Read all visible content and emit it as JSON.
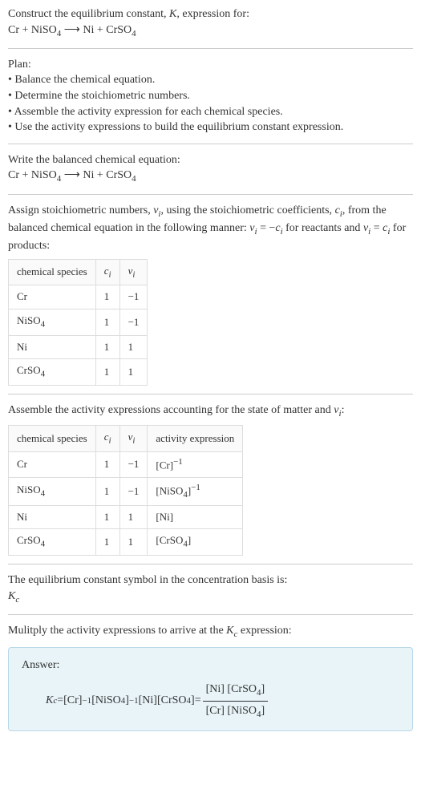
{
  "intro": {
    "line1_prefix": "Construct the equilibrium constant, ",
    "line1_K": "K",
    "line1_suffix": ", expression for:",
    "equation_lhs1": "Cr + NiSO",
    "equation_sub1": "4",
    "equation_arrow": " ⟶ ",
    "equation_rhs1": "Ni + CrSO",
    "equation_sub2": "4"
  },
  "plan": {
    "title": "Plan:",
    "item1": "• Balance the chemical equation.",
    "item2": "• Determine the stoichiometric numbers.",
    "item3": "• Assemble the activity expression for each chemical species.",
    "item4": "• Use the activity expressions to build the equilibrium constant expression."
  },
  "balanced": {
    "title": "Write the balanced chemical equation:",
    "equation_lhs1": "Cr + NiSO",
    "equation_sub1": "4",
    "equation_arrow": " ⟶ ",
    "equation_rhs1": "Ni + CrSO",
    "equation_sub2": "4"
  },
  "stoich": {
    "line1_a": "Assign stoichiometric numbers, ",
    "line1_nu": "ν",
    "line1_i": "i",
    "line1_b": ", using the stoichiometric coefficients, ",
    "line1_c": "c",
    "line1_d": ", from the balanced chemical equation in the following manner: ",
    "line1_e": " = −",
    "line1_f": " for reactants and ",
    "line1_g": " = ",
    "line1_h": " for products:",
    "table": {
      "h1": "chemical species",
      "h2": "c",
      "h2sub": "i",
      "h3": "ν",
      "h3sub": "i",
      "rows": [
        {
          "sp": "Cr",
          "c": "1",
          "nu": "−1"
        },
        {
          "sp_a": "NiSO",
          "sp_sub": "4",
          "c": "1",
          "nu": "−1"
        },
        {
          "sp": "Ni",
          "c": "1",
          "nu": "1"
        },
        {
          "sp_a": "CrSO",
          "sp_sub": "4",
          "c": "1",
          "nu": "1"
        }
      ]
    }
  },
  "activity": {
    "title_a": "Assemble the activity expressions accounting for the state of matter and ",
    "title_nu": "ν",
    "title_i": "i",
    "title_b": ":",
    "table": {
      "h1": "chemical species",
      "h2": "c",
      "h2sub": "i",
      "h3": "ν",
      "h3sub": "i",
      "h4": "activity expression",
      "rows": [
        {
          "sp": "Cr",
          "c": "1",
          "nu": "−1",
          "act_a": "[Cr]",
          "act_sup": "−1"
        },
        {
          "sp_a": "NiSO",
          "sp_sub": "4",
          "c": "1",
          "nu": "−1",
          "act_a": "[NiSO",
          "act_sub": "4",
          "act_b": "]",
          "act_sup": "−1"
        },
        {
          "sp": "Ni",
          "c": "1",
          "nu": "1",
          "act_a": "[Ni]"
        },
        {
          "sp_a": "CrSO",
          "sp_sub": "4",
          "c": "1",
          "nu": "1",
          "act_a": "[CrSO",
          "act_sub": "4",
          "act_b": "]"
        }
      ]
    }
  },
  "symbol": {
    "title": "The equilibrium constant symbol in the concentration basis is:",
    "K": "K",
    "c": "c"
  },
  "multiply": {
    "title_a": "Mulitply the activity expressions to arrive at the ",
    "title_K": "K",
    "title_c": "c",
    "title_b": " expression:"
  },
  "answer": {
    "label": "Answer:",
    "K": "K",
    "c": "c",
    "eq": " = ",
    "t1": "[Cr]",
    "t1sup": "−1",
    "sp": " ",
    "t2a": "[NiSO",
    "t2sub": "4",
    "t2b": "]",
    "t2sup": "−1",
    "t3": "[Ni] ",
    "t4a": "[CrSO",
    "t4sub": "4",
    "t4b": "]",
    "eq2": " = ",
    "num_a": "[Ni] [CrSO",
    "num_sub": "4",
    "num_b": "]",
    "den_a": "[Cr] [NiSO",
    "den_sub": "4",
    "den_b": "]"
  }
}
